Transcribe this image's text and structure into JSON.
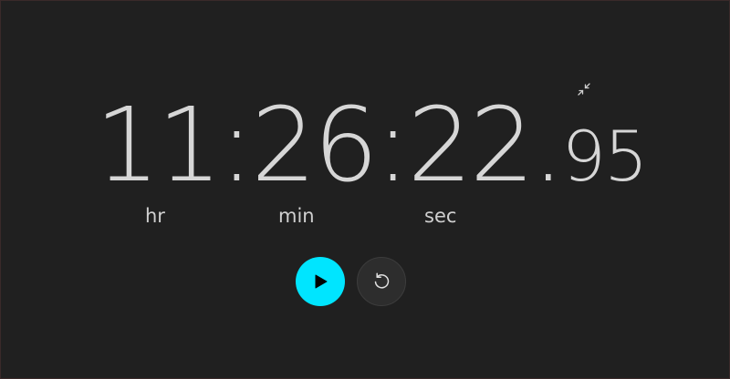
{
  "stopwatch": {
    "hours": "11",
    "separator1": ":",
    "minutes": "26",
    "separator2": ":",
    "seconds": "22",
    "decimal": ".",
    "hundredths": "95"
  },
  "units": {
    "hr": "hr",
    "min": "min",
    "sec": "sec"
  },
  "colors": {
    "background": "#202020",
    "accent": "#00e5ff",
    "text": "#d6d6d6"
  },
  "icons": {
    "compact": "compact-overlay-icon",
    "play": "play-icon",
    "reset": "reset-icon"
  }
}
